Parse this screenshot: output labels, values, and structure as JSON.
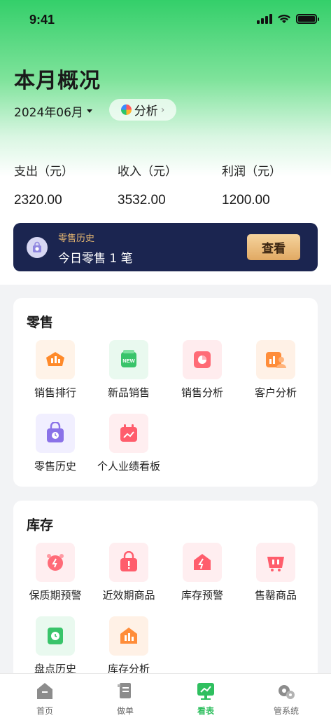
{
  "status_bar": {
    "time": "9:41"
  },
  "header": {
    "title": "本月概况",
    "month": "2024年06月",
    "analysis_label": "分析"
  },
  "stats": [
    {
      "label": "支出（元）",
      "value": "2320.00"
    },
    {
      "label": "收入（元）",
      "value": "3532.00"
    },
    {
      "label": "利润（元）",
      "value": "1200.00"
    }
  ],
  "retail_banner": {
    "subtitle": "零售历史",
    "text": "今日零售 1 笔",
    "button": "查看"
  },
  "sections": [
    {
      "title": "零售",
      "items": [
        {
          "label": "销售排行",
          "icon": "ranking-icon"
        },
        {
          "label": "新品销售",
          "icon": "new-product-icon"
        },
        {
          "label": "销售分析",
          "icon": "pie-chart-icon"
        },
        {
          "label": "客户分析",
          "icon": "customer-icon"
        },
        {
          "label": "零售历史",
          "icon": "retail-history-icon"
        },
        {
          "label": "个人业绩看板",
          "icon": "performance-icon"
        }
      ]
    },
    {
      "title": "库存",
      "items": [
        {
          "label": "保质期预警",
          "icon": "alarm-clock-icon"
        },
        {
          "label": "近效期商品",
          "icon": "expiring-bag-icon"
        },
        {
          "label": "库存预警",
          "icon": "stock-warning-icon"
        },
        {
          "label": "售罄商品",
          "icon": "sold-out-icon"
        },
        {
          "label": "盘点历史",
          "icon": "inventory-history-icon"
        },
        {
          "label": "库存分析",
          "icon": "stock-analysis-icon"
        }
      ]
    }
  ],
  "tabbar": [
    {
      "label": "首页",
      "icon": "home-icon",
      "active": false
    },
    {
      "label": "做单",
      "icon": "order-icon",
      "active": false
    },
    {
      "label": "看表",
      "icon": "chart-board-icon",
      "active": true
    },
    {
      "label": "管系统",
      "icon": "settings-icon",
      "active": false
    }
  ],
  "colors": {
    "accent": "#2fbf5f",
    "banner": "#1b2550",
    "gold": "#e1a963"
  }
}
